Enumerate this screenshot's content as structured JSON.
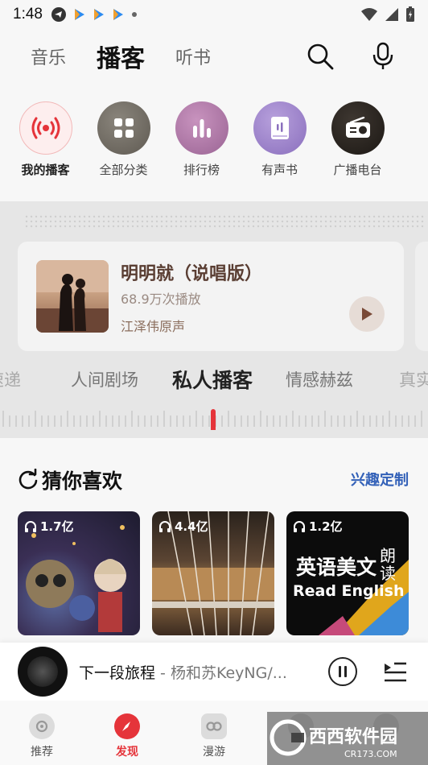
{
  "status": {
    "time": "1:48"
  },
  "header": {
    "tabs": [
      {
        "label": "音乐",
        "active": false
      },
      {
        "label": "播客",
        "active": true
      },
      {
        "label": "听书",
        "active": false
      }
    ],
    "search_icon": "search-icon",
    "mic_icon": "microphone-icon"
  },
  "categories": [
    {
      "label": "我的播客",
      "icon": "podcast-signal-icon",
      "color": "#fbeaea"
    },
    {
      "label": "全部分类",
      "icon": "grid-icon",
      "color": "#6f6a62"
    },
    {
      "label": "排行榜",
      "icon": "bar-chart-icon",
      "color": "#b07aa8"
    },
    {
      "label": "有声书",
      "icon": "book-icon",
      "color": "#a086c8"
    },
    {
      "label": "广播电台",
      "icon": "radio-icon",
      "color": "#2b2622"
    }
  ],
  "banner": {
    "title": "明明就（说唱版）",
    "plays": "68.9万次播放",
    "author": "江泽伟原声"
  },
  "channels": {
    "items": [
      "速递",
      "人间剧场",
      "私人播客",
      "情感赫兹",
      "真实"
    ],
    "active": "私人播客"
  },
  "recommend": {
    "title": "猜你喜欢",
    "custom_label": "兴趣定制",
    "items": [
      {
        "count": "1.7亿"
      },
      {
        "count": "4.4亿"
      },
      {
        "count": "1.2亿",
        "cover_cn": "英语美文",
        "cover_cn_side": "朗读",
        "cover_en": "Read English"
      }
    ]
  },
  "player": {
    "title": "下一段旅程",
    "artist": " - 杨和苏KeyNG/..."
  },
  "nav": {
    "items": [
      {
        "label": "推荐",
        "active": false
      },
      {
        "label": "发现",
        "active": true
      },
      {
        "label": "漫游",
        "active": false
      },
      {
        "label": "",
        "active": false
      },
      {
        "label": "",
        "active": false
      }
    ]
  },
  "watermark": {
    "text": "西西软件园",
    "sub": "CR173.COM"
  },
  "colors": {
    "accent": "#e5343a",
    "link": "#3361b8"
  }
}
